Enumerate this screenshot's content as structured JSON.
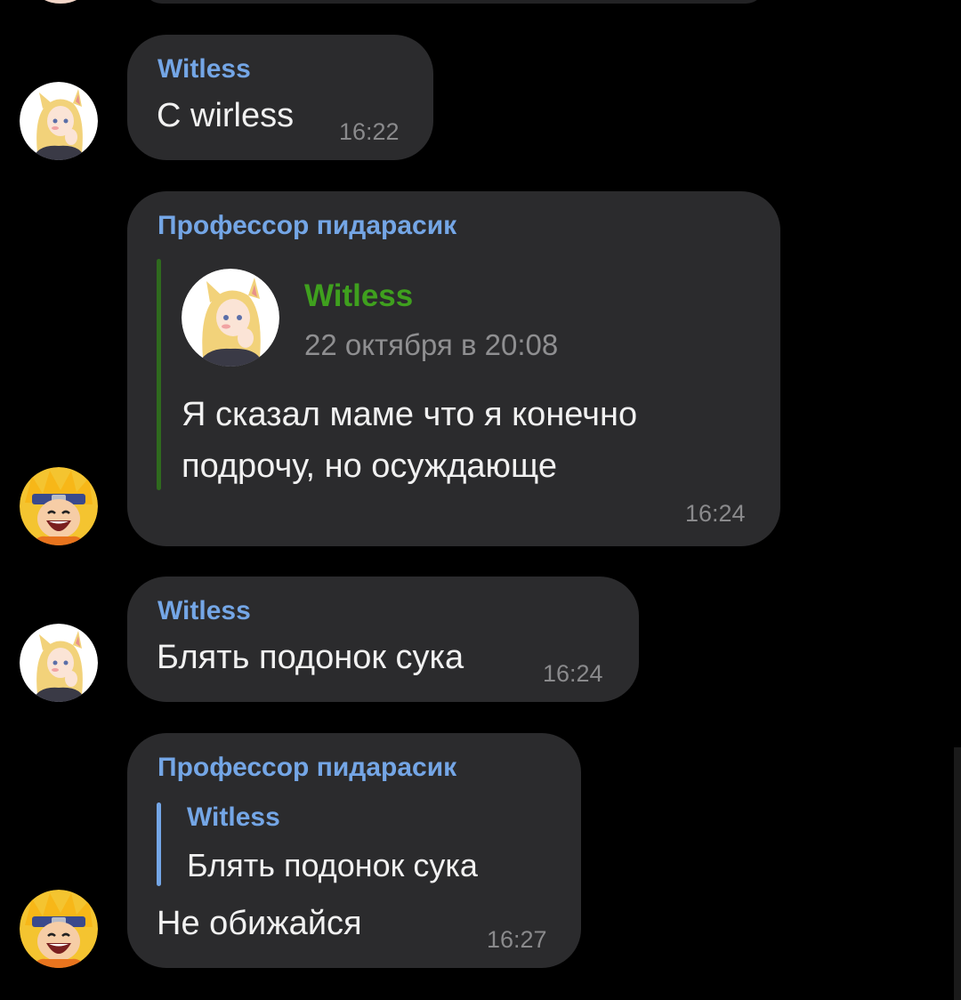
{
  "messages": [
    {
      "sender": "Witless",
      "text": "С wirless",
      "time": "16:22"
    },
    {
      "sender": "Профессор пидарасик",
      "forwarded": {
        "author": "Witless",
        "date": "22 октября в 20:08",
        "text_line1": "Я сказал маме что я конечно",
        "text_line2": "подрочу, но осуждающе"
      },
      "time": "16:24"
    },
    {
      "sender": "Witless",
      "text": "Блять подонок сука",
      "time": "16:24"
    },
    {
      "sender": "Профессор пидарасик",
      "reply": {
        "author": "Witless",
        "text": "Блять подонок сука"
      },
      "text": "Не обижайся",
      "time": "16:27"
    }
  ],
  "colors": {
    "background": "#000000",
    "bubble": "#2b2b2d",
    "sender_name": "#74a6e6",
    "forward_author": "#3fa01e",
    "forward_bar": "#2f6a1e",
    "reply_bar": "#74a6e6",
    "timestamp": "#8a8a8c",
    "text": "#f1f1f1"
  },
  "icons": {
    "witless_avatar": "anime-girl-avatar-icon",
    "professor_avatar": "anime-boy-avatar-icon"
  }
}
